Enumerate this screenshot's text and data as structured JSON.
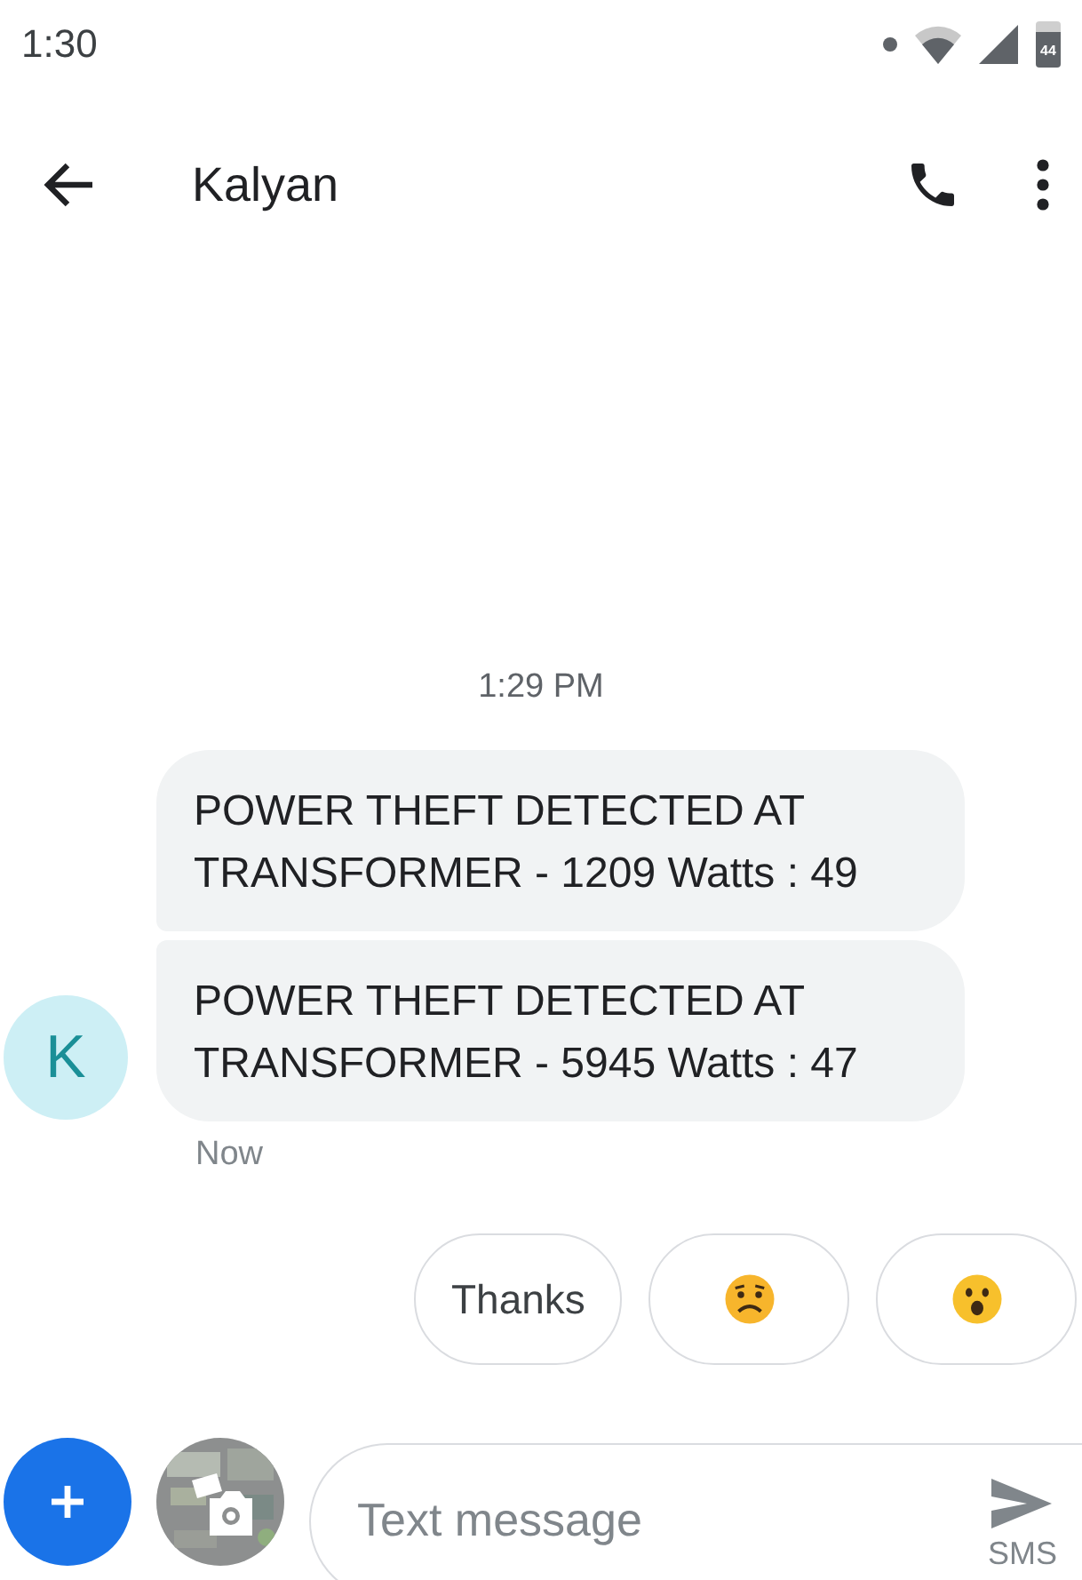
{
  "status_bar": {
    "time": "1:30",
    "battery": "44"
  },
  "header": {
    "title": "Kalyan"
  },
  "timestamp": "1:29 PM",
  "contact": {
    "initial": "K"
  },
  "messages": [
    {
      "text": "POWER THEFT DETECTED AT TRANSFORMER - 1209 Watts : 49"
    },
    {
      "text": "POWER THEFT DETECTED AT TRANSFORMER - 5945 Watts : 47"
    }
  ],
  "message_status": "Now",
  "suggestions": [
    {
      "kind": "text",
      "label": "Thanks"
    },
    {
      "kind": "worried"
    },
    {
      "kind": "surprised"
    }
  ],
  "composer": {
    "placeholder": "Text message",
    "send_label": "SMS"
  }
}
